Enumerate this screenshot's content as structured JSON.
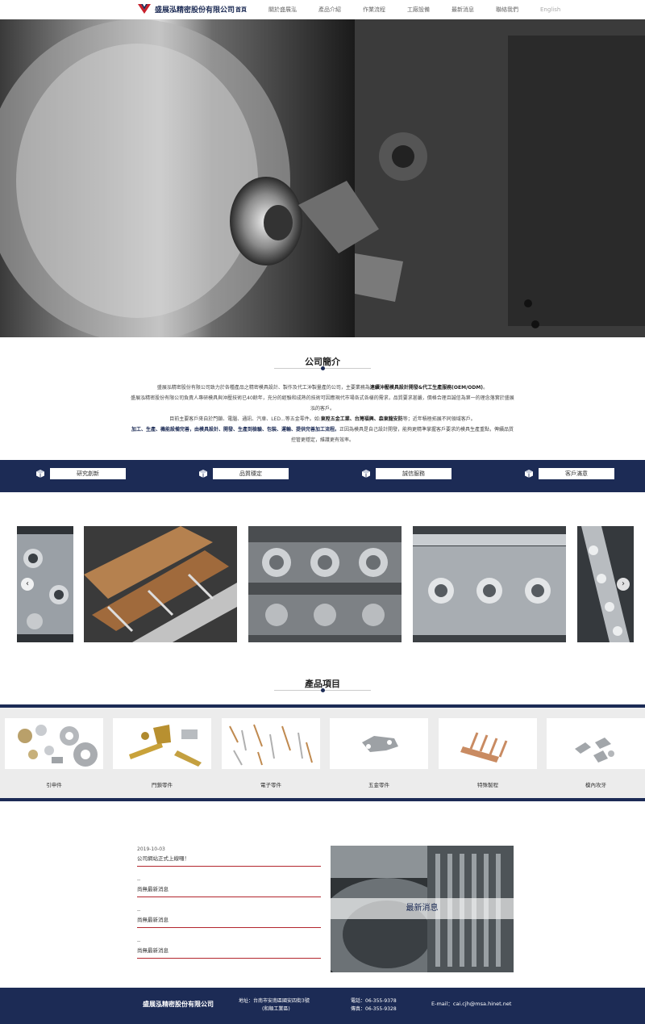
{
  "brand": {
    "company_name": "盛展泓精密股份有限公司"
  },
  "nav": {
    "items": [
      "首頁",
      "關於盛展泓",
      "產品介紹",
      "作業流程",
      "工廠設備",
      "最新消息",
      "聯絡我們",
      "English"
    ],
    "active_index": 0
  },
  "about": {
    "title": "公司簡介",
    "p1_a": "盛展泓精密股份有限公司致力於各種產品之精密模具設計、製作及代工沖製量產的公司，主要業務為",
    "p1_b": "連續沖壓模具設計開發&代工生產服務(OEM/ODM)",
    "p1_c": "。",
    "p2": "盛展泓精密股份有限公司負責人專研模具與沖壓技術已40餘年，充分的經驗和成熟的技術可因應現代市場各式各樣的需求，品質要求甚嚴，價格合理且誠信為第一的理念落實於盛展泓的客戶。",
    "p3_a": "目前主要客戶來自於門鎖、電腦、通訊、汽車、LED...等五金零件。如:",
    "p3_b": "東陞五金工業、台灣福興、森東龍安防",
    "p3_c": "等；近年積極拓展不同領域客戶。",
    "p4_a": "加工、生產、機能設備完善，由模具設計、開發、生產到檢驗、包裝、運輸、提供完善加工流程。",
    "p4_b": "正因為模具是自己設計開發，能夠更精準掌握客戶要求的模具生產重點，俾續品質控管更穩定，維護更有效率。"
  },
  "values": [
    "研究創新",
    "品質穩定",
    "誠信服務",
    "客戶滿意"
  ],
  "carousel": {
    "prev_icon": "chevron-left-icon",
    "next_icon": "chevron-right-icon"
  },
  "products": {
    "title": "產品項目",
    "items": [
      "引申件",
      "門鎖零件",
      "電子零件",
      "五金零件",
      "特殊製程",
      "模內攻牙"
    ]
  },
  "news": {
    "items": [
      {
        "date": "2019-10-03",
        "title": "公司網站正式上線囉！"
      },
      {
        "date": "--",
        "title": "尚無最新消息"
      },
      {
        "date": "--",
        "title": "尚無最新消息"
      },
      {
        "date": "--",
        "title": "尚無最新消息"
      }
    ],
    "banner": "最新消息"
  },
  "footer": {
    "company": "盛展泓精密股份有限公司",
    "address_line1": "地址：台南市安南區國安四街3號",
    "address_line2": "(和順工業區)",
    "phone": "電話：06-355-9378",
    "fax": "傳真：06-355-9328",
    "email": "E-mail：cai.cjh@msa.hinet.net"
  },
  "colors": {
    "navy": "#1c2b55",
    "accent_red": "#b3262e",
    "band_gray": "#ececec"
  }
}
